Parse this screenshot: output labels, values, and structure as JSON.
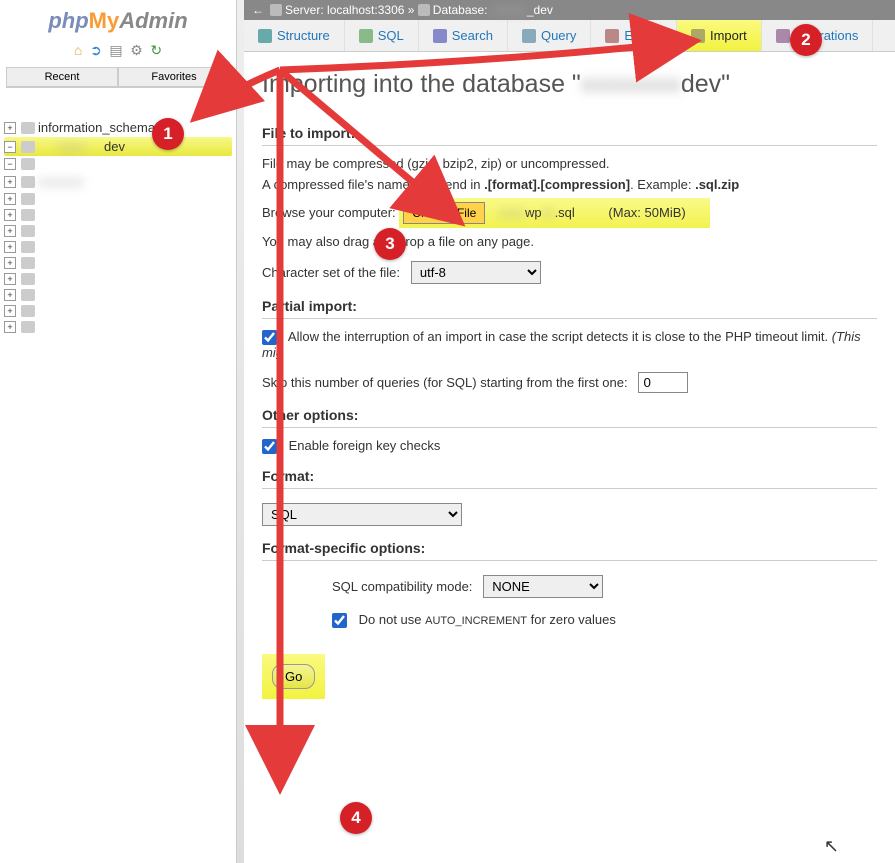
{
  "logo": {
    "php": "php",
    "my": "My",
    "admin": "Admin"
  },
  "sidebar_tabs": {
    "recent": "Recent",
    "favorites": "Favorites"
  },
  "tree": {
    "items": [
      {
        "label": "information_schema",
        "highlighted": false
      },
      {
        "label": "dev",
        "highlighted": true
      }
    ]
  },
  "breadcrumb": {
    "server_label": "Server:",
    "server_value": "localhost:3306",
    "sep": "»",
    "db_label": "Database:",
    "db_value_suffix": "_dev"
  },
  "main_tabs": [
    {
      "id": "structure",
      "label": "Structure"
    },
    {
      "id": "sql",
      "label": "SQL"
    },
    {
      "id": "search",
      "label": "Search"
    },
    {
      "id": "query",
      "label": "Query"
    },
    {
      "id": "export",
      "label": "Export"
    },
    {
      "id": "import",
      "label": "Import",
      "active": true
    },
    {
      "id": "operations",
      "label": "Operations"
    }
  ],
  "heading": {
    "prefix": "Importing into the database \"",
    "suffix": "dev\""
  },
  "file_to_import": {
    "title": "File to import:",
    "line1": "File may be compressed (gzip, bzip2, zip) or uncompressed.",
    "line2a": "A compressed file's name must end in ",
    "line2b": ".[format].[compression]",
    "line2c": ". Example: ",
    "line2d": ".sql.zip",
    "browse_prefix": "Browse your computer: ",
    "choose_file": "Choose File",
    "file_name_prefix": "wp",
    "file_name_suffix": ".sql",
    "max": "(Max: 50MiB)",
    "drag_note": "You may also drag and drop a file on any page.",
    "charset_label": "Character set of the file:",
    "charset_value": "utf-8"
  },
  "partial_import": {
    "title": "Partial import:",
    "interrupt_label": "Allow the interruption of an import in case the script detects it is close to the PHP timeout limit.",
    "interrupt_note": "(This mig",
    "skip_label": "Skip this number of queries (for SQL) starting from the first one:",
    "skip_value": "0"
  },
  "other_options": {
    "title": "Other options:",
    "fk_label": "Enable foreign key checks"
  },
  "format": {
    "title": "Format:",
    "value": "SQL"
  },
  "format_specific": {
    "title": "Format-specific options:",
    "compat_label": "SQL compatibility mode:",
    "compat_value": "NONE",
    "autoinc_prefix": "Do not use ",
    "autoinc_code": "AUTO_INCREMENT",
    "autoinc_suffix": " for zero values"
  },
  "go_button": "Go",
  "annotations": {
    "b1": "1",
    "b2": "2",
    "b3": "3",
    "b4": "4"
  }
}
